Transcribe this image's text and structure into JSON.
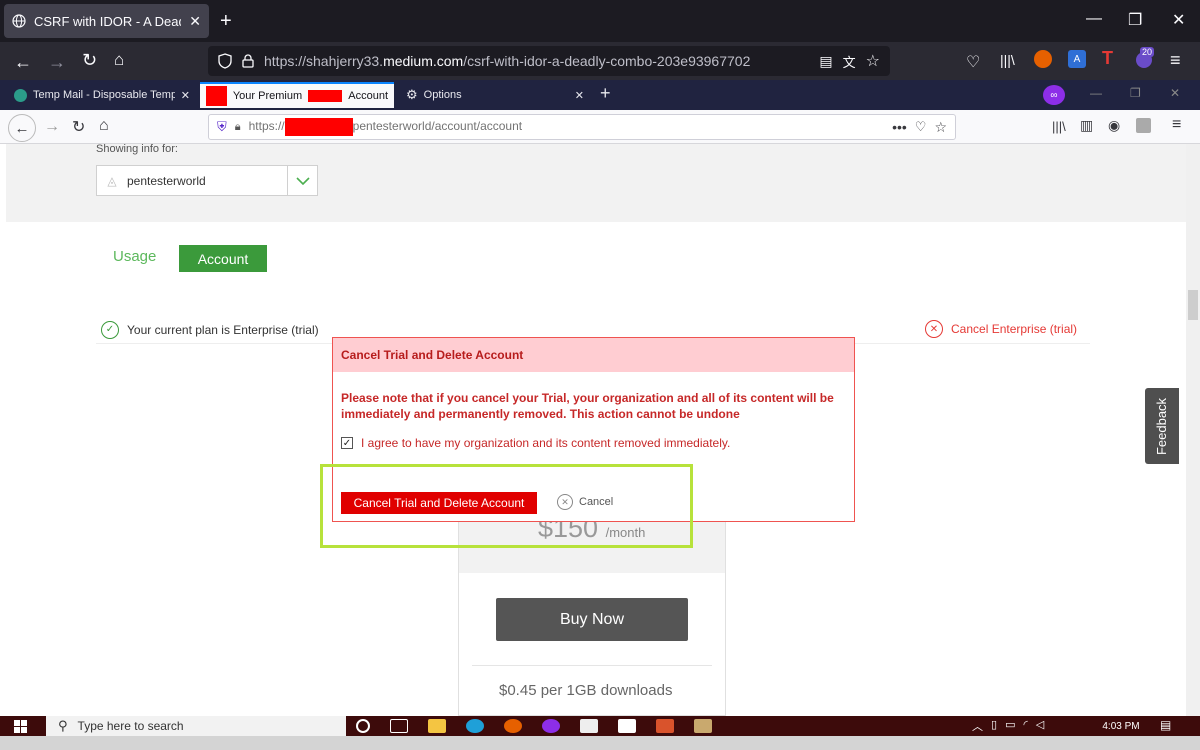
{
  "outer_browser": {
    "tab_title": "CSRF with IDOR - A Deadly Com",
    "url_prefix": "https://shahjerry33.",
    "url_domain": "medium.com",
    "url_path": "/csrf-with-idor-a-deadly-combo-203e93967702",
    "badge_count": "20"
  },
  "inner_browser": {
    "tabs": [
      {
        "label": "Temp Mail - Disposable Tempo"
      },
      {
        "label_a": "Your Premium",
        "label_b": "Account"
      },
      {
        "label": "Options"
      }
    ],
    "url_prefix": "https://",
    "url_path": "pentesterworld/account/account"
  },
  "page": {
    "showing_info_label": "Showing info for:",
    "org_name": "pentesterworld",
    "tabs": {
      "usage": "Usage",
      "account": "Account"
    },
    "plan_text": "Your current plan is Enterprise (trial)",
    "cancel_plan_link": "Cancel Enterprise (trial)",
    "price_value": "$150",
    "price_unit": "/month",
    "buy_now": "Buy Now",
    "downloads_text": "$0.45 per 1GB downloads",
    "feedback": "Feedback"
  },
  "modal": {
    "title": "Cancel Trial and Delete Account",
    "warning": "Please note that if you cancel your Trial, your organization and all of its content will be immediately and permanently removed. This action cannot be undone",
    "agree_text": "I agree to have my organization and its content removed immediately.",
    "agree_checked": true,
    "confirm_button": "Cancel Trial and Delete Account",
    "cancel_button": "Cancel"
  },
  "taskbar": {
    "search_placeholder": "Type here to search",
    "time": "4:03 PM"
  },
  "colors": {
    "accent_green": "#3b9a3b",
    "danger_red": "#e00000",
    "highlight_green": "#b7e23b"
  }
}
